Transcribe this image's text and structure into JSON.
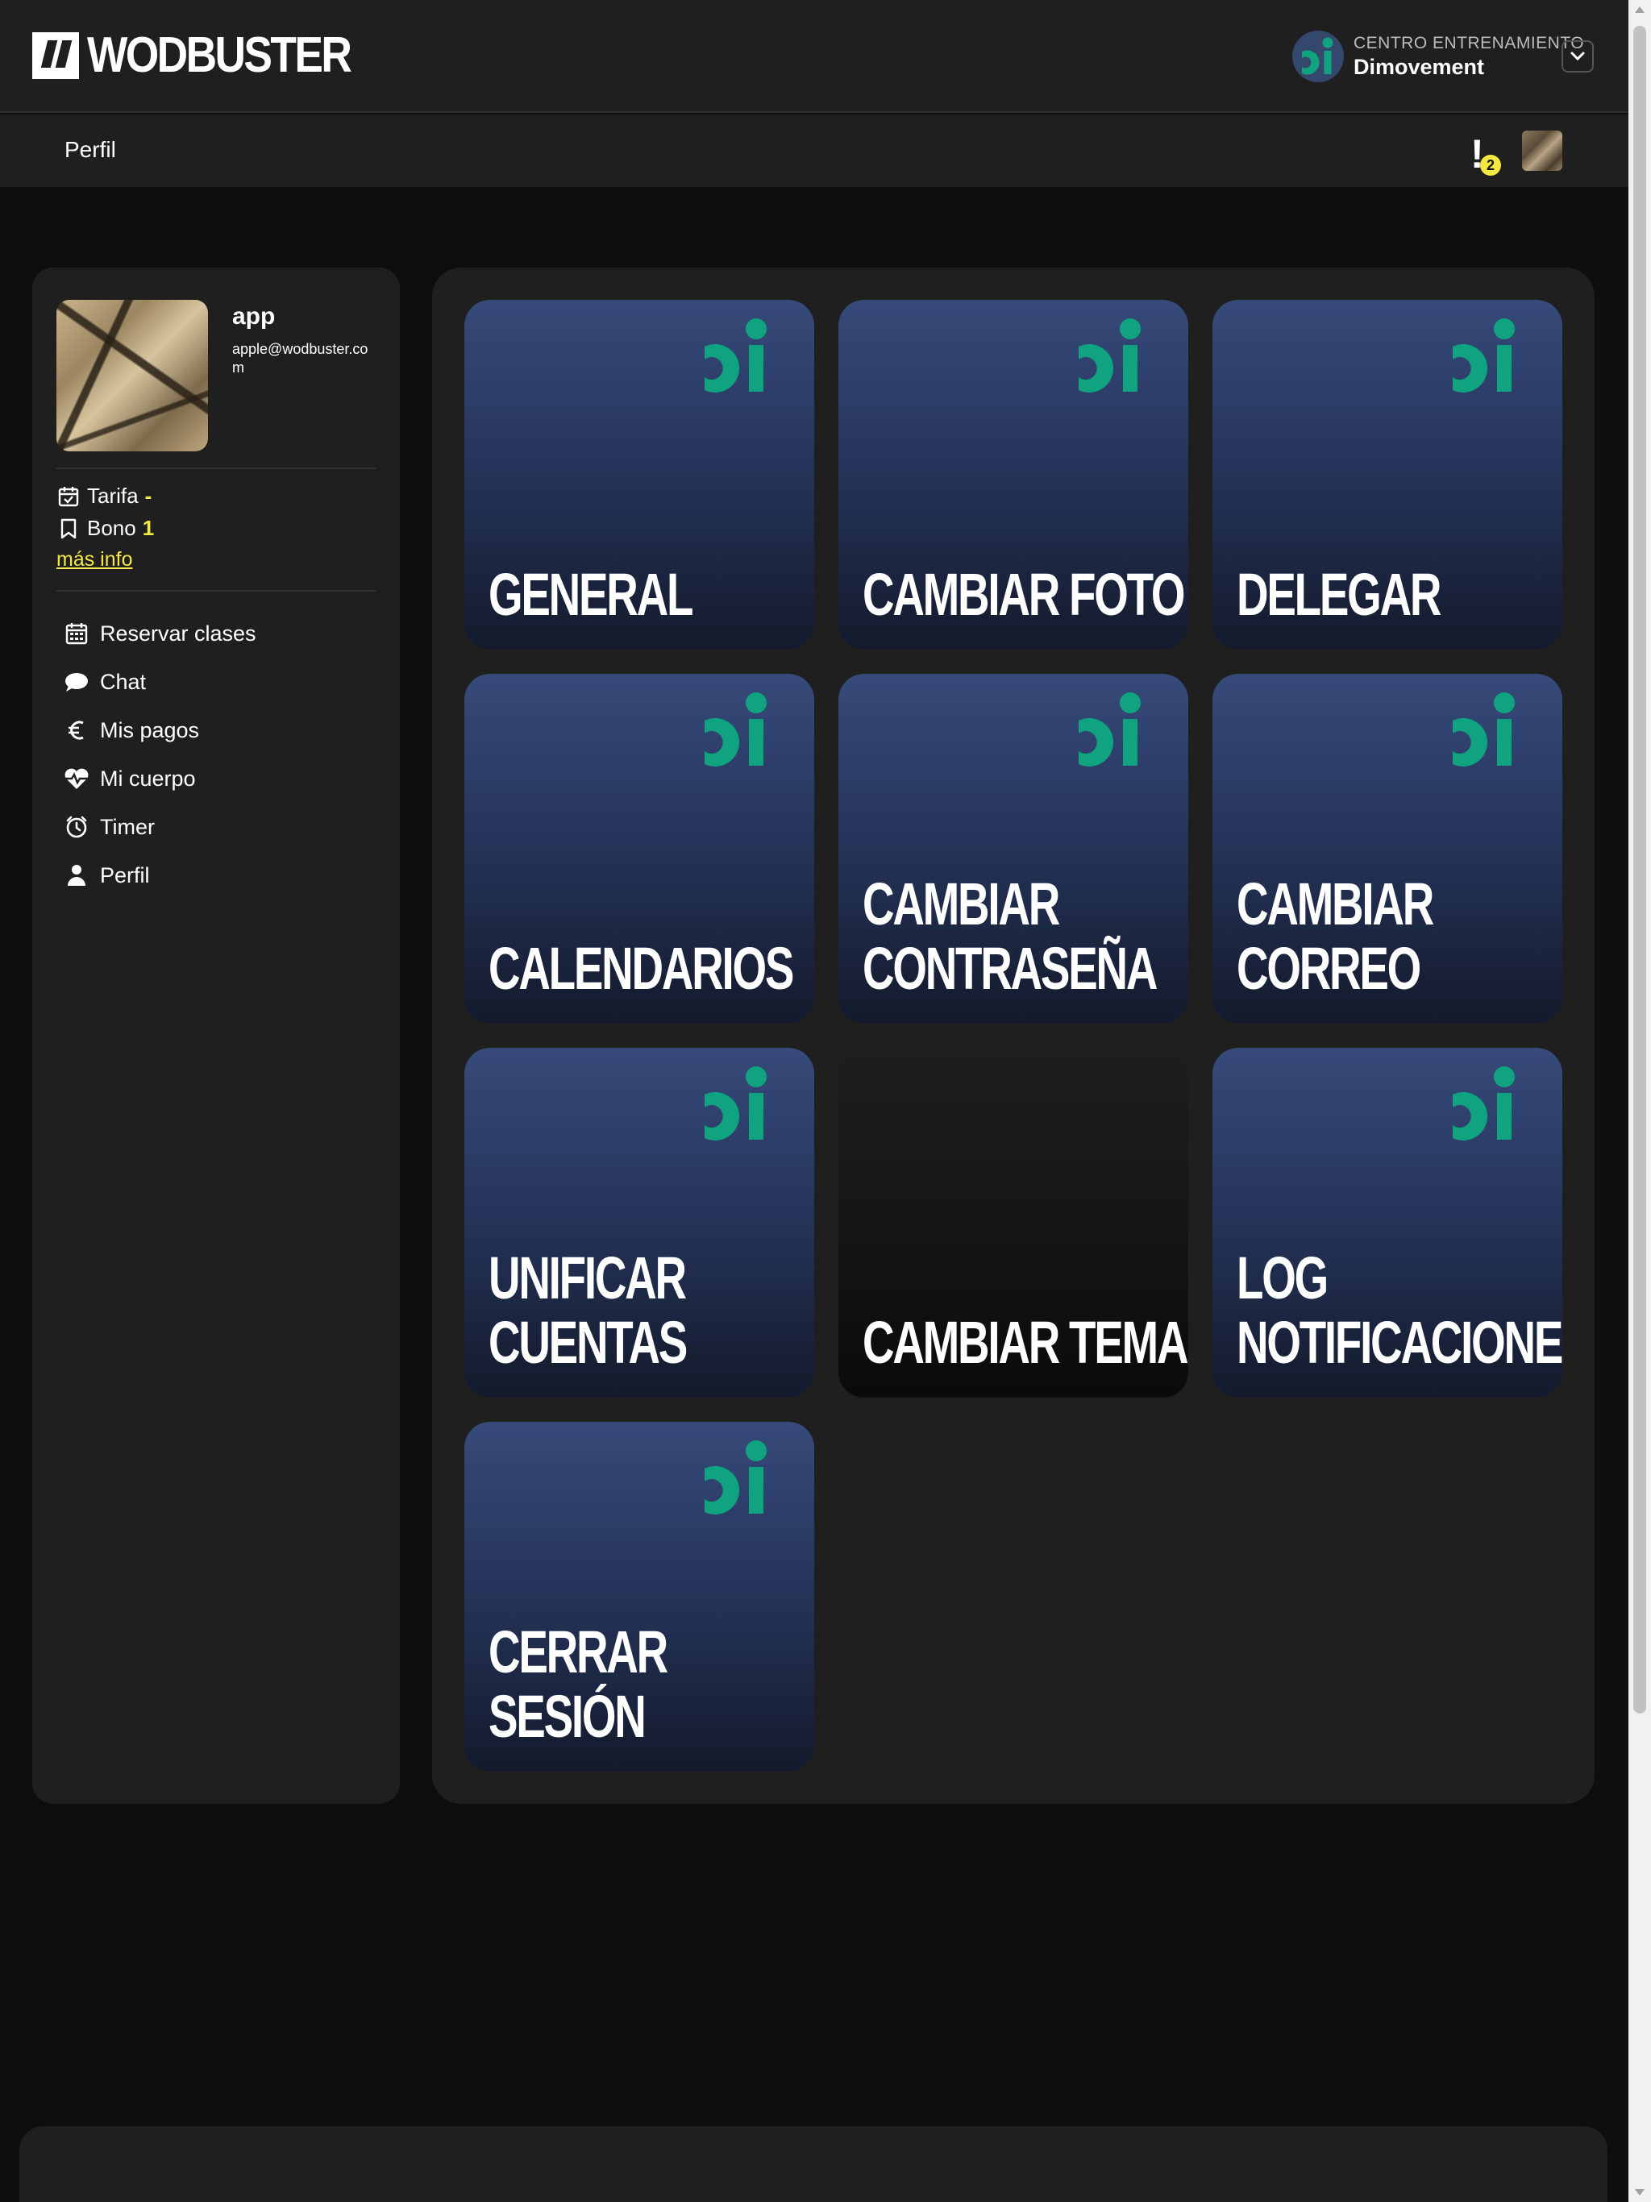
{
  "header": {
    "logo_text": "WODBUSTER",
    "center_label": "CENTRO ENTRENAMIENTO",
    "center_name": "Dimovement",
    "dropdown_icon": "chevron-down-icon"
  },
  "subnav": {
    "title": "Perfil",
    "notification_mark": "!",
    "notification_count": "2"
  },
  "profile": {
    "name": "app",
    "email": "apple@wodbuster.com",
    "tarifa_label": "Tarifa",
    "tarifa_value": "-",
    "bono_label": "Bono",
    "bono_value": "1",
    "more_info": "más info"
  },
  "sidebar": {
    "items": [
      {
        "label": "Reservar clases",
        "icon": "calendar-icon"
      },
      {
        "label": "Chat",
        "icon": "chat-icon"
      },
      {
        "label": "Mis pagos",
        "icon": "euro-icon"
      },
      {
        "label": "Mi cuerpo",
        "icon": "heart-pulse-icon"
      },
      {
        "label": "Timer",
        "icon": "timer-icon"
      },
      {
        "label": "Perfil",
        "icon": "user-icon"
      }
    ]
  },
  "tiles": [
    {
      "label": "GENERAL"
    },
    {
      "label": "CAMBIAR FOTO"
    },
    {
      "label": "DELEGAR"
    },
    {
      "label": "CALENDARIOS"
    },
    {
      "label": "CAMBIAR CONTRASEÑA"
    },
    {
      "label": "CAMBIAR CORREO"
    },
    {
      "label": "UNIFICAR CUENTAS"
    },
    {
      "label": "CAMBIAR TEMA"
    },
    {
      "label": "LOG NOTIFICACIONES"
    },
    {
      "label": "CERRAR SESIÓN"
    }
  ],
  "colors": {
    "accent": "#f4e842",
    "brand_green": "#10a37f",
    "tile_blue": "#364a7a",
    "background": "#0e0e0e",
    "panel": "#1f1f1f"
  }
}
